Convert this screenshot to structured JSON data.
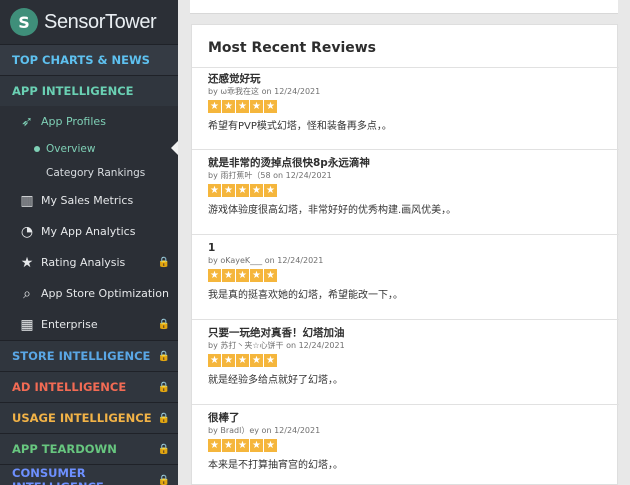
{
  "brand": {
    "name": "SensorTower",
    "logo_icon": "sensor-tower-logo"
  },
  "sidebar": {
    "sections": [
      {
        "label": "TOP CHARTS & NEWS",
        "color": "#5ec1f0"
      },
      {
        "label": "APP INTELLIGENCE",
        "color": "#6ad0b3"
      }
    ],
    "items": [
      {
        "label": "App Profiles",
        "icon": "cursor-icon"
      },
      {
        "label": "My Sales Metrics",
        "icon": "bar-chart-icon"
      },
      {
        "label": "My App Analytics",
        "icon": "gauge-icon"
      },
      {
        "label": "Rating Analysis",
        "icon": "star-icon"
      },
      {
        "label": "App Store Optimization",
        "icon": "search-icon"
      },
      {
        "label": "Enterprise",
        "icon": "building-icon"
      }
    ],
    "subitems": [
      {
        "label": "Overview"
      },
      {
        "label": "Category Rankings"
      }
    ],
    "bottom_sections": [
      {
        "label": "STORE INTELLIGENCE",
        "color": "#5aa7e6"
      },
      {
        "label": "AD INTELLIGENCE",
        "color": "#f26b54"
      },
      {
        "label": "USAGE INTELLIGENCE",
        "color": "#f2b347"
      },
      {
        "label": "APP TEARDOWN",
        "color": "#67c67f"
      },
      {
        "label": "CONSUMER INTELLIGENCE",
        "color": "#6d90ff"
      }
    ]
  },
  "reviews_card": {
    "title": "Most Recent Reviews",
    "reviews": [
      {
        "title": "还感觉好玩",
        "author": "ω乖我在这",
        "date": "12/24/2021",
        "rating": 5,
        "body": "希望有PVP模式幻塔，怪和装备再多点，。"
      },
      {
        "title": "就是非常的烫掉点很快8p永远滴神",
        "author": "雨打蕉叶（58",
        "date": "12/24/2021",
        "rating": 5,
        "body": "游戏体验度很高幻塔，非常好好的优秀构建.画风优美，。"
      },
      {
        "title": "1",
        "author": "oKayeK___",
        "date": "12/24/2021",
        "rating": 5,
        "body": "我是真的挺喜欢她的幻塔，希望能改一下，。"
      },
      {
        "title": "只要一玩绝对真香！幻塔加油",
        "author": "苏打丶夹☆心饼干",
        "date": "12/24/2021",
        "rating": 5,
        "body": "就是经验多给点就好了幻塔，。"
      },
      {
        "title": "很棒了",
        "author": "Bradl）ey",
        "date": "12/24/2021",
        "rating": 5,
        "body": "本来是不打算抽宵宫的幻塔，。"
      }
    ]
  },
  "colors": {
    "star": "#f5b63c",
    "selected_nav": "#7fd0b6"
  }
}
